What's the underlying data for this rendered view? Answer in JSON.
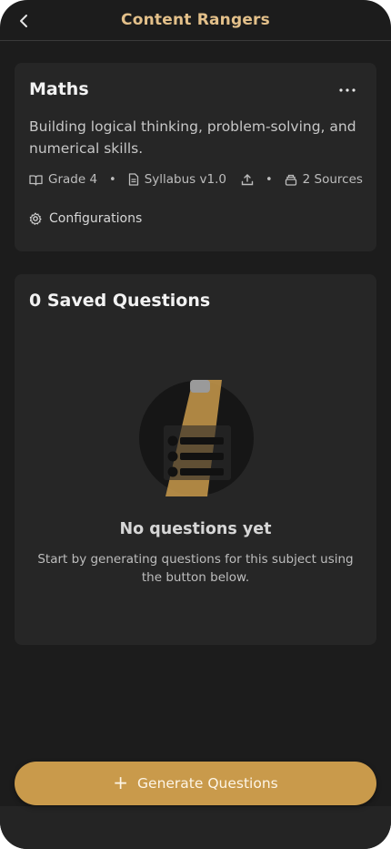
{
  "header": {
    "title": "Content Rangers"
  },
  "subject": {
    "name": "Maths",
    "description": "Building logical thinking, problem-solving, and numerical skills.",
    "grade": "Grade 4",
    "syllabus": "Syllabus v1.0",
    "sources": "2 Sources",
    "configurations_label": "Configurations"
  },
  "saved": {
    "title": "0 Saved Questions",
    "empty_title": "No questions yet",
    "empty_desc": "Start by generating questions for this subject using the button below."
  },
  "actions": {
    "generate_label": "Generate Questions",
    "plus": "+",
    "bullet": "•"
  },
  "icons": {
    "back": "chevron-left-icon",
    "more": "more-horizontal-icon",
    "grade": "book-open-icon",
    "syllabus": "file-text-icon",
    "upload": "upload-icon",
    "sources": "stack-icon",
    "config": "gear-icon"
  },
  "colors": {
    "accent": "#e3c08a",
    "button": "#c99a4b",
    "background": "#1c1c1c",
    "card": "#262626"
  }
}
